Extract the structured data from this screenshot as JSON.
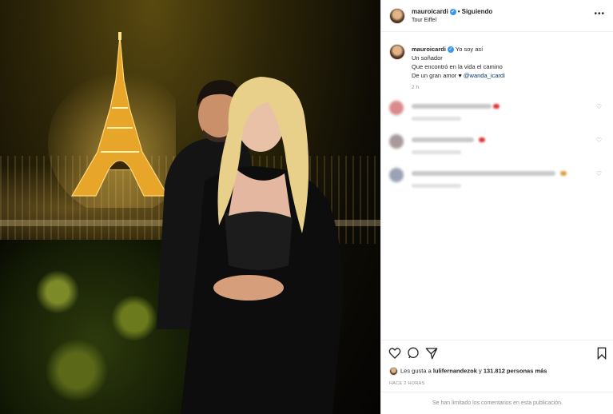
{
  "post": {
    "username": "mauroicardi",
    "follow_label": "Siguiendo",
    "location": "Tour Eiffel",
    "verified_mark": "✓",
    "caption": {
      "username": "mauroicardi",
      "line1": "Yo soy así",
      "line2": "Un soñador",
      "line3": "Que encontró en la vida el camino",
      "line4_prefix": "De un gran amor ♥",
      "mention": "@wanda_icardi"
    },
    "time_ago": "2 h",
    "likes_prefix": "Les gusta a",
    "likes_user": "lulifernandezok",
    "likes_middle": "y",
    "likes_count": "131.812 personas más",
    "posted_ago": "HACE 2 HORAS",
    "comments_disabled": "Se han limitado los comentarios en esta publicación."
  },
  "icons": {
    "more": "more-options-icon",
    "like": "heart-icon",
    "comment": "comment-icon",
    "share": "share-icon",
    "save": "bookmark-icon"
  },
  "colors": {
    "accent_blue": "#3897f0",
    "mention": "#00376b",
    "muted": "#8e8e8e"
  }
}
